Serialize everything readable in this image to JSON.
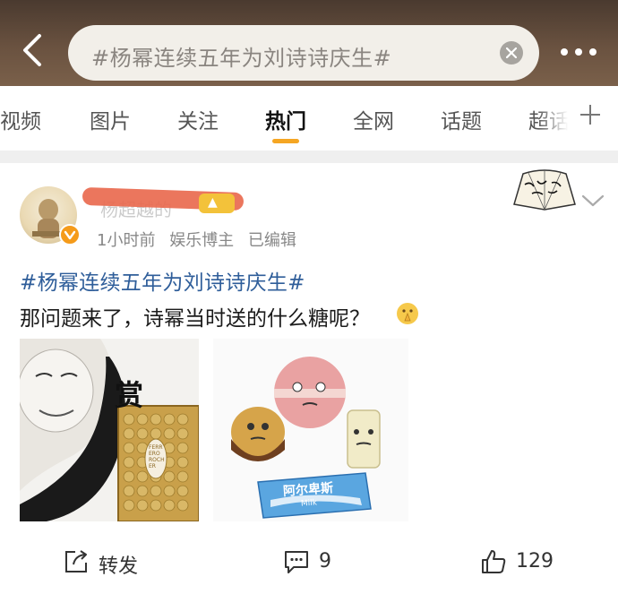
{
  "header": {
    "search_query": "#杨幂连续五年为刘诗诗庆生#"
  },
  "tabs": [
    {
      "label": "视频"
    },
    {
      "label": "图片"
    },
    {
      "label": "关注"
    },
    {
      "label": "热门",
      "active": true
    },
    {
      "label": "全网"
    },
    {
      "label": "话题"
    },
    {
      "label": "超话"
    }
  ],
  "post": {
    "author": "杨超越的",
    "meta": {
      "time": "1小时前",
      "category": "娱乐博主",
      "edited": "已编辑"
    },
    "hashtag": "#杨幂连续五年为刘诗诗庆生#",
    "text": "那问题来了，诗幂当时送的什么糖呢？",
    "image1_caption": "赏",
    "image1_box_label": "FERRERO ROCHER",
    "image2_wrapper_label": "阿尔卑斯",
    "image2_wrapper_sub": "Milk",
    "actions": {
      "repost_label": "转发",
      "comment_count": "9",
      "like_count": "129"
    }
  },
  "colors": {
    "accent": "#f5a623",
    "hashtag": "#2f5e9a",
    "header_bg": "#5a4535"
  }
}
